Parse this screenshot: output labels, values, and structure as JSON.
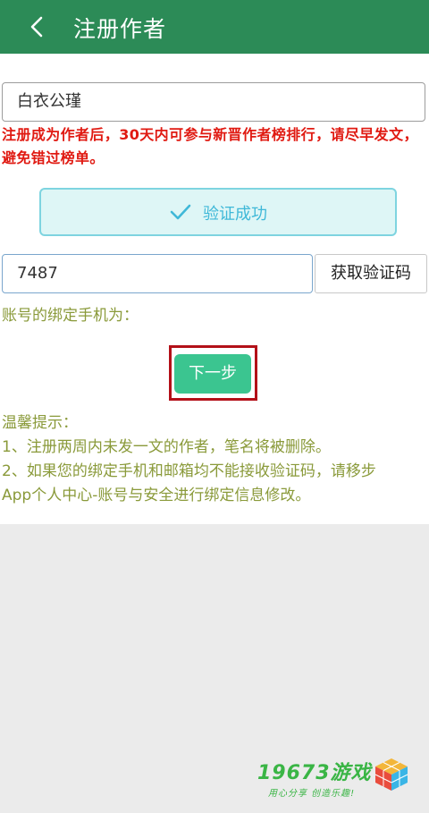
{
  "header": {
    "title": "注册作者",
    "back_icon": "chevron-left-icon"
  },
  "form": {
    "pen_name_value": "白衣公瑾",
    "notice": "注册成为作者后，30天内可参与新晋作者榜排行，请尽早发文，避免错过榜单。",
    "verify_status": "验证成功",
    "verify_icon": "checkmark-icon",
    "code_value": "7487",
    "get_code_label": "获取验证码",
    "phone_label": "账号的绑定手机为：",
    "next_label": "下一步"
  },
  "tips": {
    "title": "温馨提示：",
    "items": [
      "1、注册两周内未发一文的作者，笔名将被删除。",
      "2、如果您的绑定手机和邮箱均不能接收验证码，请移步",
      "App个人中心-账号与安全进行绑定信息修改。"
    ]
  },
  "watermark": {
    "brand": "19673游戏",
    "slogan": "用心分享  创造乐趣!"
  },
  "colors": {
    "header": "#2c8b57",
    "notice": "#e01a12",
    "verify_bg": "#def6f6",
    "verify_text": "#3fb8d8",
    "next_button": "#3bc590",
    "highlight": "#b31018",
    "tips_text": "#8a9a3a"
  }
}
